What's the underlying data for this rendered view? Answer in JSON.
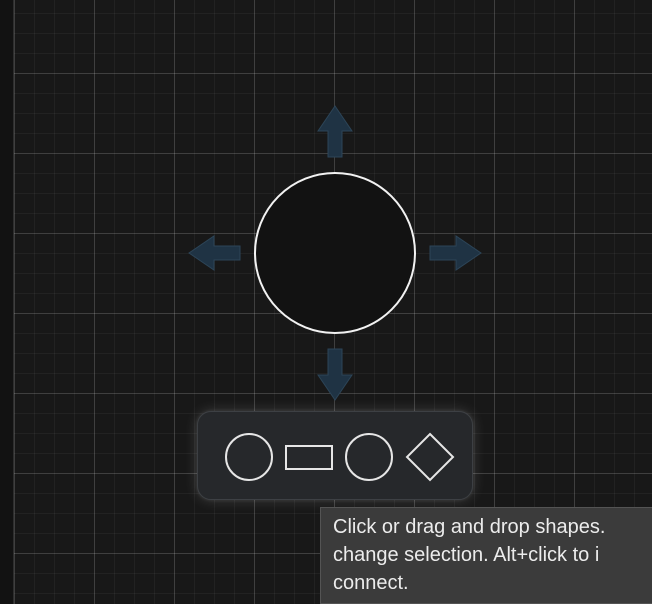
{
  "canvas": {
    "selected_shape": "ellipse",
    "connection_arrows": [
      "up",
      "right",
      "down",
      "left"
    ],
    "arrow_color": "#1f3344",
    "grid": true
  },
  "shape_toolbar": {
    "items": [
      {
        "name": "ellipse",
        "icon": "ellipse-icon"
      },
      {
        "name": "rectangle",
        "icon": "rectangle-icon"
      },
      {
        "name": "circle",
        "icon": "circle-icon"
      },
      {
        "name": "diamond",
        "icon": "diamond-icon"
      }
    ]
  },
  "tooltip": {
    "lines": [
      "Click or drag and drop shapes. ",
      "change selection. Alt+click to i",
      "connect."
    ]
  }
}
